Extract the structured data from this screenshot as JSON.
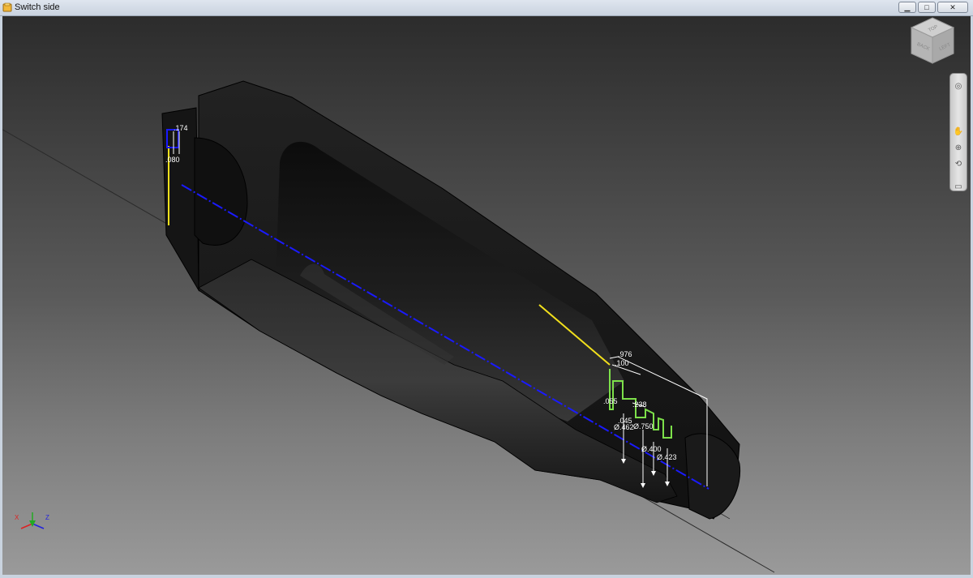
{
  "window": {
    "title": "Switch side",
    "buttons": {
      "minimize": "▁",
      "maximize": "□",
      "close": "✕"
    }
  },
  "viewcube": {
    "faces": {
      "top": "TOP",
      "front": "BACK",
      "right": "LEFT"
    }
  },
  "navbar": {
    "items": [
      {
        "name": "steering-wheel-icon",
        "glyph": "◎"
      },
      {
        "name": "pan-icon",
        "glyph": "✋"
      },
      {
        "name": "zoom-icon",
        "glyph": "⊕"
      },
      {
        "name": "orbit-icon",
        "glyph": "⟲"
      },
      {
        "name": "look-at-icon",
        "glyph": "▭"
      }
    ]
  },
  "triad": {
    "x_label": "X",
    "z_label": "Z"
  },
  "dimensions": {
    "d174": ".174",
    "d080": ".080",
    "d976": ".976",
    "d100": ".100",
    "d055": ".055",
    "d238": ".238",
    "d045": ".045",
    "dia462": "Ø.462",
    "dia750": "Ø.750",
    "dia400": "Ø.400",
    "dia423": "Ø.423"
  },
  "colors": {
    "centerline": "#1a1aff",
    "sketch_yellow": "#f2e01c",
    "sketch_green": "#7de04a",
    "dimension_white": "#ffffff"
  }
}
